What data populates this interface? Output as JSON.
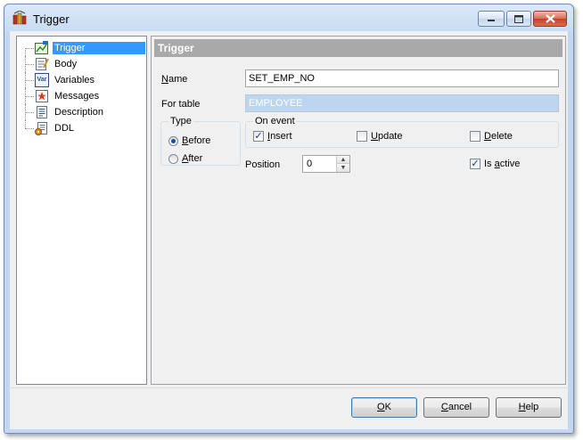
{
  "window": {
    "title": "Trigger"
  },
  "tree": {
    "items": [
      {
        "label": "Trigger",
        "icon": "trigger-icon",
        "selected": true
      },
      {
        "label": "Body",
        "icon": "body-icon"
      },
      {
        "label": "Variables",
        "icon": "variables-icon",
        "icon_text": "Var"
      },
      {
        "label": "Messages",
        "icon": "messages-icon"
      },
      {
        "label": "Description",
        "icon": "description-icon"
      },
      {
        "label": "DDL",
        "icon": "ddl-icon"
      }
    ]
  },
  "panel": {
    "header": "Trigger",
    "name": {
      "label_first": "N",
      "label_rest": "ame",
      "value": "SET_EMP_NO"
    },
    "for_table": {
      "label": "For table",
      "value": "EMPLOYEE"
    },
    "type": {
      "legend": "Type",
      "before": {
        "first": "B",
        "rest": "efore",
        "checked": true
      },
      "after": {
        "first": "A",
        "rest": "fter",
        "checked": false
      }
    },
    "on_event": {
      "legend": "On event",
      "insert": {
        "first": "I",
        "rest": "nsert",
        "checked": true
      },
      "update": {
        "first": "U",
        "rest": "pdate",
        "checked": false
      },
      "delete": {
        "first": "D",
        "rest": "elete",
        "checked": false
      }
    },
    "position": {
      "label": "Position",
      "value": "0"
    },
    "is_active": {
      "before": "Is ",
      "first": "a",
      "rest": "ctive",
      "checked": true
    }
  },
  "footer": {
    "ok": {
      "first": "O",
      "rest": "K"
    },
    "cancel": {
      "first": "C",
      "rest": "ancel"
    },
    "help": {
      "first": "H",
      "rest": "elp"
    }
  },
  "glyphs": {
    "check": "✓",
    "spin_up": "▲",
    "spin_down": "▼"
  }
}
